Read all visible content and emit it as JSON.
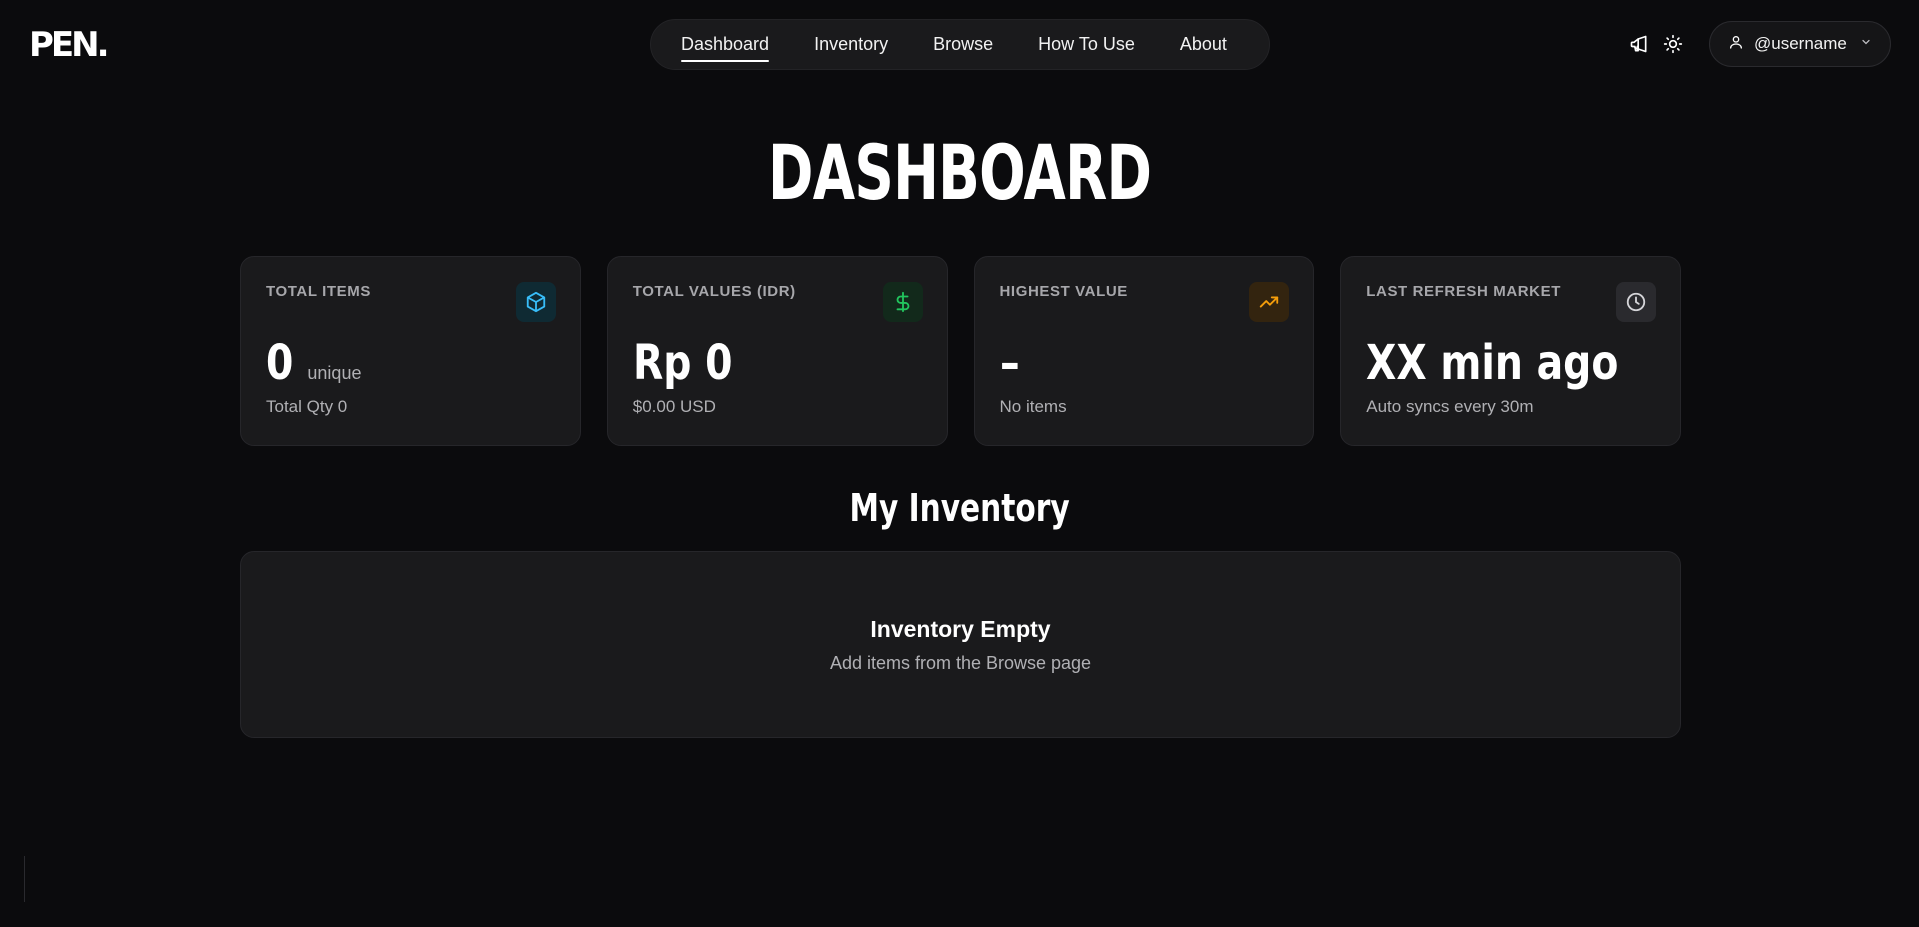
{
  "header": {
    "logo_text": "PEN.",
    "nav": [
      {
        "label": "Dashboard",
        "active": true
      },
      {
        "label": "Inventory",
        "active": false
      },
      {
        "label": "Browse",
        "active": false
      },
      {
        "label": "How To Use",
        "active": false
      },
      {
        "label": "About",
        "active": false
      }
    ],
    "icons": [
      "megaphone-icon",
      "sun-icon"
    ],
    "user": {
      "name": "@username",
      "icon": "user-icon",
      "dropdown_icon": "chevron-down-icon"
    }
  },
  "page_title": "DASHBOARD",
  "stats": [
    {
      "label": "TOTAL ITEMS",
      "value": "0",
      "unit": "unique",
      "sub": "Total Qty 0",
      "icon": "cube-icon",
      "icon_color": "#38bdf8",
      "icon_bg": "#0f2a33"
    },
    {
      "label": "TOTAL VALUES (IDR)",
      "value": "Rp 0",
      "unit": "",
      "sub": "$0.00 USD",
      "icon": "dollar-icon",
      "icon_color": "#22c55e",
      "icon_bg": "#12291b"
    },
    {
      "label": "HIGHEST VALUE",
      "value": "–",
      "unit": "",
      "sub": "No items",
      "icon": "trending-up-icon",
      "icon_color": "#f59e0b",
      "icon_bg": "#33240f"
    },
    {
      "label": "LAST REFRESH MARKET",
      "value": "XX min ago",
      "unit": "",
      "sub": "Auto syncs every 30m",
      "icon": "clock-icon",
      "icon_color": "#d4d4d8",
      "icon_bg": "#2a2a2e"
    }
  ],
  "inventory": {
    "title": "My Inventory",
    "empty_title": "Inventory Empty",
    "empty_subtitle": "Add items from the Browse page"
  },
  "colors": {
    "background": "#0b0b0d",
    "card": "#1a1a1c",
    "text_muted": "#b0b0b4"
  }
}
